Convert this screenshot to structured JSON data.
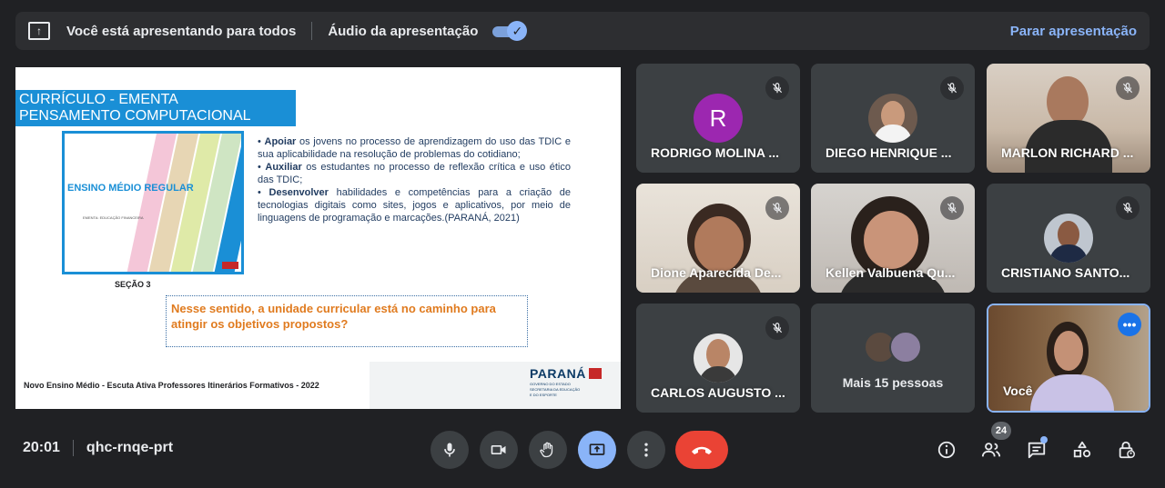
{
  "banner": {
    "presenting_label": "Você está apresentando para todos",
    "audio_label": "Áudio da apresentação",
    "audio_enabled": true,
    "stop_label": "Parar apresentação"
  },
  "slide": {
    "title_line1": "CURRÍCULO - EMENTA",
    "title_line2": "PENSAMENTO COMPUTACIONAL",
    "thumb_title": "ENSINO MÉDIO REGULAR",
    "thumb_subtitle": "EMENTA: EDUCAÇÃO FINANCEIRA",
    "section_label": "SEÇÃO 3",
    "bullets": [
      {
        "bold": "Apoiar",
        "text": " os jovens no processo de aprendizagem do uso das TDIC e sua aplicabilidade na resolução de problemas do cotidiano;"
      },
      {
        "bold": "Auxiliar",
        "text": " os estudantes no processo de reflexão crítica e uso ético das TDIC;"
      },
      {
        "bold": "Desenvolver",
        "text": " habilidades e competências para a criação de tecnologias digitais como sites, jogos e aplicativos, por meio de linguagens de programação e marcações.(PARANÁ, 2021)"
      }
    ],
    "question": "Nesse sentido, a unidade curricular está no caminho para atingir os objetivos propostos?",
    "footer": "Novo Ensino Médio - Escuta Ativa Professores Itinerários Formativos - 2022",
    "logo_text": "PARANÁ",
    "logo_sub1": "GOVERNO DO ESTADO",
    "logo_sub2": "SECRETARIA DA EDUCAÇÃO",
    "logo_sub3": "E DO ESPORTE"
  },
  "participants": [
    {
      "name": "RODRIGO MOLINA ...",
      "initial": "R",
      "muted": true
    },
    {
      "name": "DIEGO HENRIQUE ...",
      "muted": true
    },
    {
      "name": "MARLON RICHARD ...",
      "muted": true
    },
    {
      "name": "Dione Aparecida De...",
      "muted": true
    },
    {
      "name": "Kellen Valbuena Qu...",
      "muted": true
    },
    {
      "name": "CRISTIANO SANTO...",
      "muted": true
    },
    {
      "name": "CARLOS AUGUSTO ...",
      "muted": true
    },
    {
      "name": "Mais 15 pessoas"
    },
    {
      "name": "Você"
    }
  ],
  "bottom": {
    "time": "20:01",
    "meeting_code": "qhc-rnqe-prt",
    "participant_count": "24"
  },
  "colors": {
    "accent": "#8ab4f8",
    "end_call": "#ea4335",
    "slide_blue": "#1a8fd6",
    "question_orange": "#e07b1f"
  }
}
